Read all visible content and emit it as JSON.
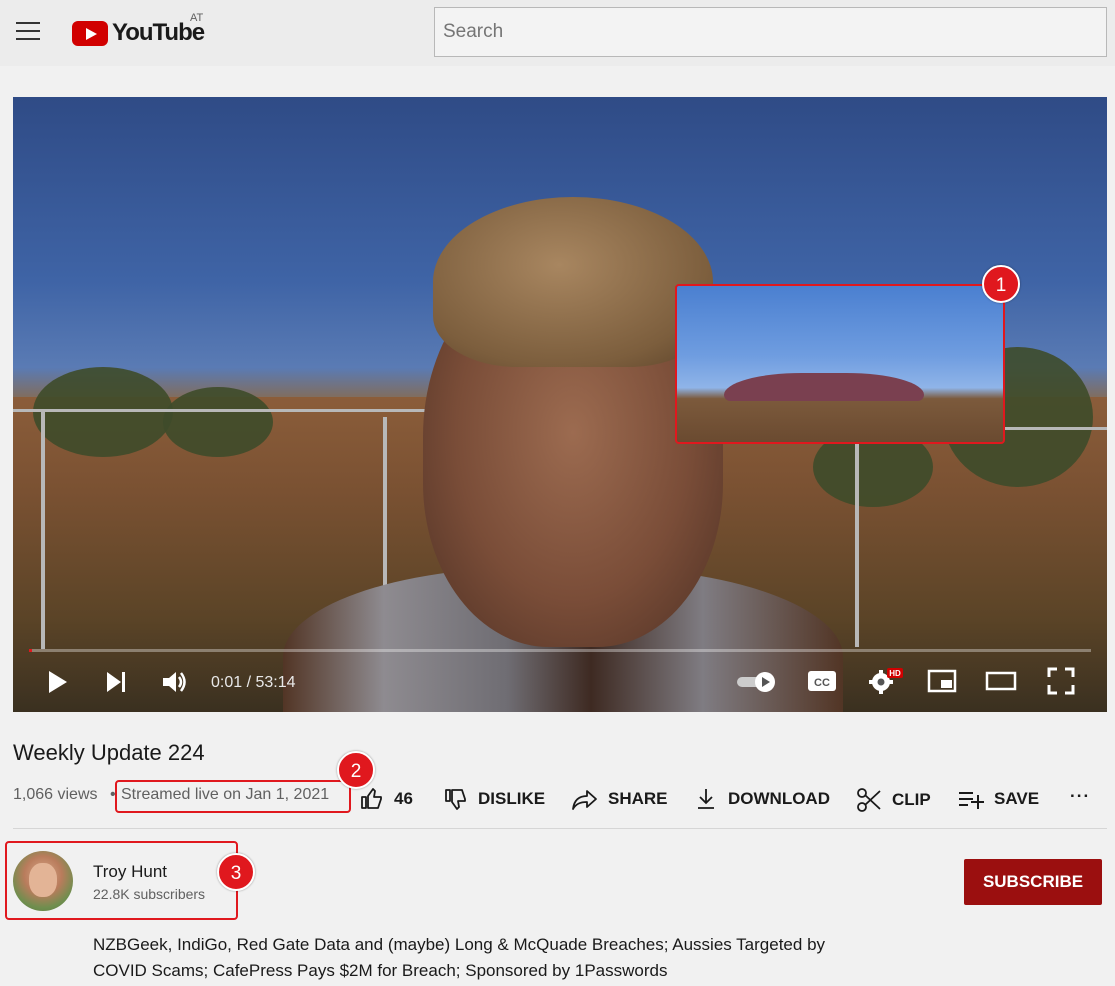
{
  "header": {
    "logo_text": "YouTube",
    "country_code": "AT",
    "search_placeholder": "Search"
  },
  "player": {
    "time_display": "0:01 / 53:14",
    "progress_fraction": 0.0003,
    "settings_badge": "HD",
    "cc_label": "CC"
  },
  "video": {
    "title": "Weekly Update 224",
    "views": "1,066 views",
    "separator": "•",
    "streamed": "Streamed live on Jan 1, 2021"
  },
  "actions": {
    "like_count": "46",
    "dislike_label": "DISLIKE",
    "share_label": "SHARE",
    "download_label": "DOWNLOAD",
    "clip_label": "CLIP",
    "save_label": "SAVE",
    "more_label": "..."
  },
  "channel": {
    "name": "Troy Hunt",
    "subscribers": "22.8K subscribers",
    "subscribe_label": "SUBSCRIBE"
  },
  "description": "NZBGeek, IndiGo, Red Gate Data and (maybe) Long & McQuade Breaches; Aussies Targeted by COVID Scams; CafePress Pays $2M for Breach; Sponsored by 1Passwords",
  "annotations": [
    "1",
    "2",
    "3"
  ],
  "colors": {
    "annotation_red": "#e0181e",
    "subscribe_bg": "#9b0f0f",
    "brand_red": "#d10000"
  }
}
